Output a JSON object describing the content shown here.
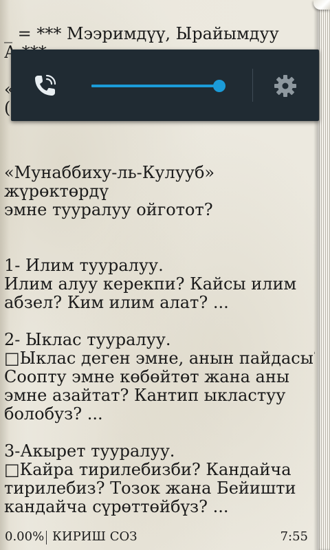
{
  "reader": {
    "lines": [
      "_ = *** Мээримдүү, Ырайымдуу",
      "А                         ***",
      "«",
      "(",
      "«Мунаббиху-ль-Кулууб»",
      "жүрөктөрдү",
      "эмне тууралуу ойготот?",
      "1- Илим тууралуу.",
      "Илим алуу керекпи? Кайсы илим",
      "абзел? Ким илим алат? ...",
      "2- Ыклас тууралуу.",
      "□Ыклас деген эмне, анын пайдасы?",
      "Соопту эмне көбөйтөт жана аны",
      "эмне азайтат? Кантип ыкластуу",
      "болобуз? ...",
      "3-Акырет тууралуу.",
      "□Кайра тирилебизби? Кандайча",
      "тирилебиз? Тозок жана Бейишти",
      "кандайча сүрөттөйбүз? ..."
    ]
  },
  "volume_panel": {
    "stream_icon": "phone-call-volume-icon",
    "level": 1.0,
    "settings_icon": "gear-icon",
    "accent_color": "#1b9bd8",
    "background_color": "#202b33"
  },
  "footer": {
    "progress": "0.00%",
    "chapter": "КИРИШ СОЗ",
    "clock": "7:55"
  }
}
